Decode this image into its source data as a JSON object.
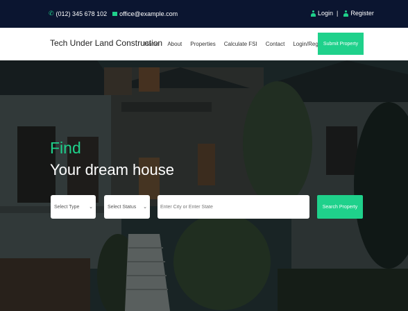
{
  "topbar": {
    "phone": "(012) 345 678 102",
    "email": "office@example.com",
    "login": "Login",
    "separator": "|",
    "register": "Register"
  },
  "nav": {
    "brand": "Tech Under Land Construction",
    "items": [
      "Home",
      "About",
      "Properties",
      "Calculate FSI",
      "Contact",
      "Login/Register"
    ],
    "submit_label": "Submit Property"
  },
  "hero": {
    "find": "Find",
    "headline": "Your dream house"
  },
  "search": {
    "type_selected": "Select Type",
    "status_selected": "Select Status",
    "location_placeholder": "Enter City or Enter State",
    "button_label": "Search Property"
  },
  "colors": {
    "accent": "#1fd18b",
    "topbar_bg": "#0b1530"
  },
  "icons": [
    "phone-icon",
    "mail-icon",
    "user-icon",
    "chevron-down-icon"
  ]
}
